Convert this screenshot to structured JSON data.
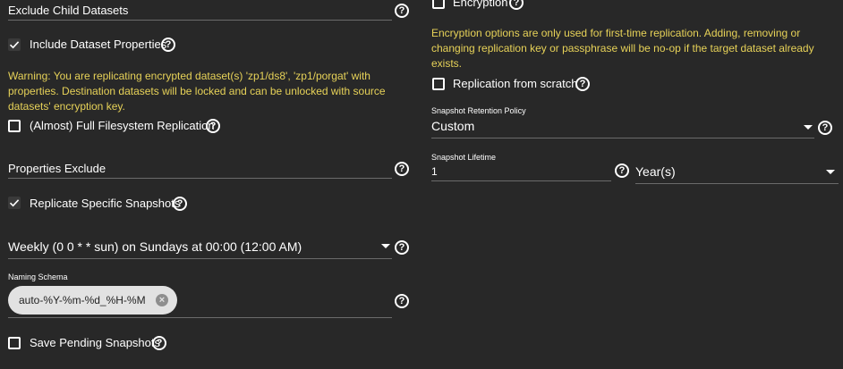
{
  "left": {
    "exclude_child": {
      "label": "Exclude Child Datasets"
    },
    "include_props": {
      "label": "Include Dataset Properties",
      "checked": true
    },
    "warning": {
      "line1": "Warning: You are replicating encrypted dataset(s) 'zp1/ds8', 'zp1/porgat' with",
      "line2": "properties. Destination datasets will be locked and can be unlocked with source",
      "line3": "datasets' encryption key."
    },
    "full_fs": {
      "label": "(Almost) Full Filesystem Replication",
      "checked": false
    },
    "properties_exclude": {
      "label": "Properties Exclude"
    },
    "specific_snapshots": {
      "label": "Replicate Specific Snapshots",
      "checked": true
    },
    "schedule": {
      "value": "Weekly (0 0 * * sun) on Sundays at 00:00 (12:00 AM)"
    },
    "naming_schema": {
      "label": "Naming Schema",
      "chip": "auto-%Y-%m-%d_%H-%M"
    },
    "save_pending": {
      "label": "Save Pending Snapshots",
      "checked": false
    }
  },
  "right": {
    "encryption": {
      "label": "Encryption",
      "checked": false
    },
    "enc_note": {
      "line1": "Encryption options are only used for first-time replication. Adding, removing or",
      "line2": "changing replication key or passphrase will be no-op if the target dataset already",
      "line3": "exists."
    },
    "from_scratch": {
      "label": "Replication from scratch",
      "checked": false
    },
    "retention": {
      "label": "Snapshot Retention Policy",
      "value": "Custom"
    },
    "lifetime": {
      "label": "Snapshot Lifetime",
      "value": "1",
      "unit": "Year(s)"
    }
  },
  "icons": {
    "help": "help-circle-icon",
    "check": "check-icon",
    "caret": "caret-down-icon",
    "chip_remove": "close-circle-icon"
  },
  "colors": {
    "background": "#282828",
    "text": "#ffffff",
    "warning": "#e7d258",
    "underline": "#6b6b6b",
    "chip_bg": "#e2e2e2"
  }
}
